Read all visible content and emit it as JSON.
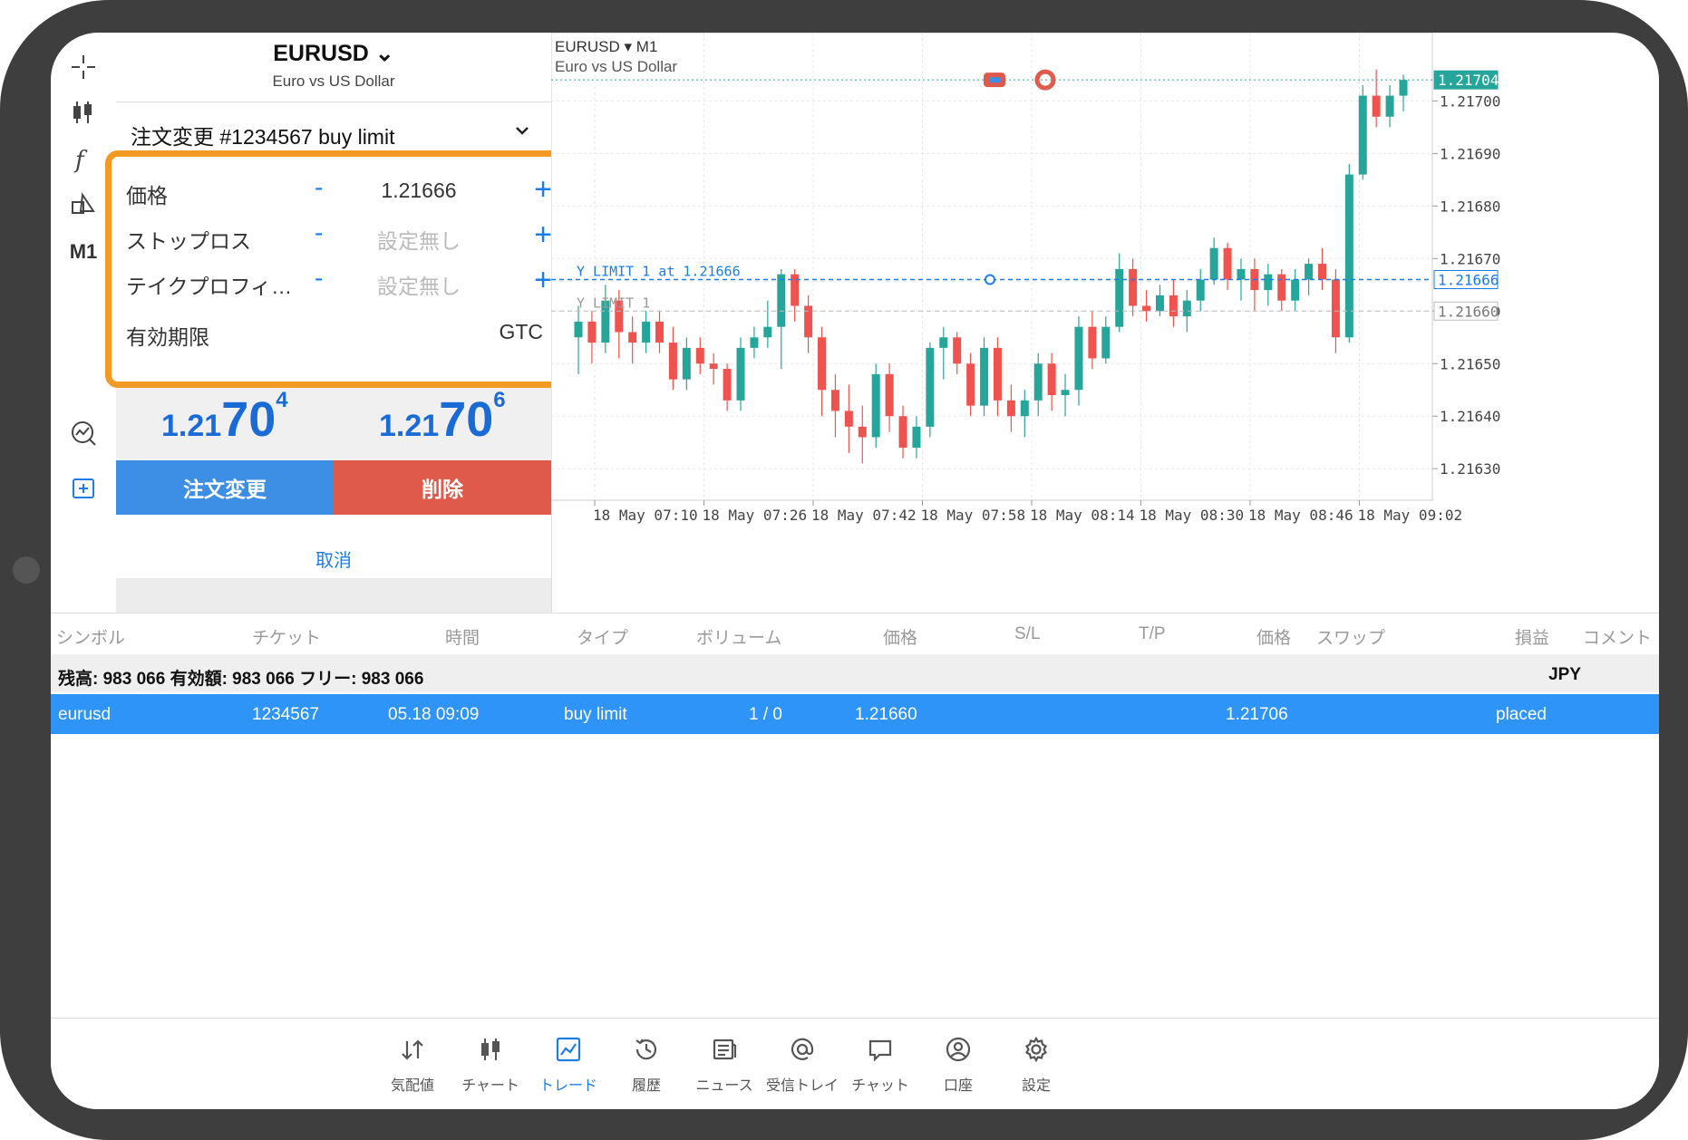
{
  "toolbar": {
    "timeframe": "M1"
  },
  "order_panel": {
    "symbol": "EURUSD",
    "symbol_chevron": "⌄",
    "symbol_desc": "Euro vs US Dollar",
    "order_title": "注文変更 #1234567 buy limit",
    "fields": {
      "price": {
        "label": "価格",
        "value": "1.21666"
      },
      "stop_loss": {
        "label": "ストップロス",
        "placeholder": "設定無し"
      },
      "take_profit": {
        "label": "テイクプロフィ…",
        "placeholder": "設定無し"
      },
      "expiry": {
        "label": "有効期限",
        "value": "GTC"
      }
    },
    "minus": "-",
    "plus": "+",
    "bid": {
      "front": "1.21",
      "big": "70",
      "sup": "4"
    },
    "ask": {
      "front": "1.21",
      "big": "70",
      "sup": "6"
    },
    "modify_button": "注文変更",
    "delete_button": "削除",
    "cancel_link": "取消"
  },
  "chart": {
    "symbol": "EURUSD",
    "timeframe": "M1",
    "description": "Euro vs US Dollar",
    "line_label_blue": "Y LIMIT 1 at 1.21666",
    "line_label_gray": "Y LIMIT 1",
    "current_price": "1.21704",
    "limit_price": "1.21666",
    "gray_price": "1.21660"
  },
  "chart_data": {
    "type": "candlestick",
    "title": "EURUSD, M1",
    "y_ticks": [
      "1.21700",
      "1.21690",
      "1.21680",
      "1.21670",
      "1.21660",
      "1.21650",
      "1.21640",
      "1.21630"
    ],
    "x_ticks": [
      "18 May 07:10",
      "18 May 07:26",
      "18 May 07:42",
      "18 May 07:58",
      "18 May 08:14",
      "18 May 08:30",
      "18 May 08:46",
      "18 May 09:02"
    ],
    "ylim": [
      1.21624,
      1.21713
    ],
    "candles": [
      [
        1.21655,
        1.21661,
        1.21648,
        1.21658
      ],
      [
        1.21658,
        1.2166,
        1.2165,
        1.21654
      ],
      [
        1.21654,
        1.21665,
        1.21652,
        1.21662
      ],
      [
        1.21662,
        1.21664,
        1.21651,
        1.21656
      ],
      [
        1.21656,
        1.21659,
        1.2165,
        1.21654
      ],
      [
        1.21654,
        1.2166,
        1.21652,
        1.21658
      ],
      [
        1.21658,
        1.2166,
        1.21652,
        1.21654
      ],
      [
        1.21654,
        1.21657,
        1.21645,
        1.21647
      ],
      [
        1.21647,
        1.21655,
        1.21645,
        1.21653
      ],
      [
        1.21653,
        1.21655,
        1.21648,
        1.2165
      ],
      [
        1.2165,
        1.21652,
        1.21646,
        1.21649
      ],
      [
        1.21649,
        1.2165,
        1.21641,
        1.21643
      ],
      [
        1.21643,
        1.21655,
        1.21641,
        1.21653
      ],
      [
        1.21653,
        1.21657,
        1.21651,
        1.21655
      ],
      [
        1.21655,
        1.21662,
        1.21653,
        1.21657
      ],
      [
        1.21657,
        1.21668,
        1.21649,
        1.21667
      ],
      [
        1.21667,
        1.21668,
        1.21658,
        1.21661
      ],
      [
        1.21661,
        1.21663,
        1.21652,
        1.21655
      ],
      [
        1.21655,
        1.21657,
        1.2164,
        1.21645
      ],
      [
        1.21645,
        1.21648,
        1.21636,
        1.21641
      ],
      [
        1.21641,
        1.21646,
        1.21633,
        1.21638
      ],
      [
        1.21638,
        1.21642,
        1.21631,
        1.21636
      ],
      [
        1.21636,
        1.2165,
        1.21634,
        1.21648
      ],
      [
        1.21648,
        1.2165,
        1.21637,
        1.2164
      ],
      [
        1.2164,
        1.21642,
        1.21632,
        1.21634
      ],
      [
        1.21634,
        1.2164,
        1.21632,
        1.21638
      ],
      [
        1.21638,
        1.21654,
        1.21636,
        1.21653
      ],
      [
        1.21653,
        1.21657,
        1.21647,
        1.21655
      ],
      [
        1.21655,
        1.21656,
        1.21648,
        1.2165
      ],
      [
        1.2165,
        1.21652,
        1.2164,
        1.21642
      ],
      [
        1.21642,
        1.21655,
        1.2164,
        1.21653
      ],
      [
        1.21653,
        1.21655,
        1.2164,
        1.21643
      ],
      [
        1.21643,
        1.21646,
        1.21637,
        1.2164
      ],
      [
        1.2164,
        1.21645,
        1.21636,
        1.21643
      ],
      [
        1.21643,
        1.21652,
        1.2164,
        1.2165
      ],
      [
        1.2165,
        1.21652,
        1.21641,
        1.21644
      ],
      [
        1.21644,
        1.21648,
        1.2164,
        1.21645
      ],
      [
        1.21645,
        1.21659,
        1.21642,
        1.21657
      ],
      [
        1.21657,
        1.2166,
        1.21649,
        1.21651
      ],
      [
        1.21651,
        1.21659,
        1.2165,
        1.21657
      ],
      [
        1.21657,
        1.21671,
        1.21656,
        1.21668
      ],
      [
        1.21668,
        1.2167,
        1.21659,
        1.21661
      ],
      [
        1.21661,
        1.21664,
        1.21658,
        1.2166
      ],
      [
        1.2166,
        1.21665,
        1.21659,
        1.21663
      ],
      [
        1.21663,
        1.21666,
        1.21657,
        1.21659
      ],
      [
        1.21659,
        1.21664,
        1.21656,
        1.21662
      ],
      [
        1.21662,
        1.21668,
        1.2166,
        1.21666
      ],
      [
        1.21666,
        1.21674,
        1.21665,
        1.21672
      ],
      [
        1.21672,
        1.21673,
        1.21664,
        1.21666
      ],
      [
        1.21666,
        1.2167,
        1.21662,
        1.21668
      ],
      [
        1.21668,
        1.2167,
        1.2166,
        1.21664
      ],
      [
        1.21664,
        1.21669,
        1.21661,
        1.21667
      ],
      [
        1.21667,
        1.21668,
        1.2166,
        1.21662
      ],
      [
        1.21662,
        1.21668,
        1.2166,
        1.21666
      ],
      [
        1.21666,
        1.2167,
        1.21663,
        1.21669
      ],
      [
        1.21669,
        1.21672,
        1.21664,
        1.21666
      ],
      [
        1.21666,
        1.21668,
        1.21652,
        1.21655
      ],
      [
        1.21655,
        1.21688,
        1.21654,
        1.21686
      ],
      [
        1.21686,
        1.21703,
        1.21685,
        1.21701
      ],
      [
        1.21701,
        1.21706,
        1.21695,
        1.21697
      ],
      [
        1.21697,
        1.21703,
        1.21695,
        1.21701
      ],
      [
        1.21701,
        1.21705,
        1.21698,
        1.21704
      ]
    ]
  },
  "table": {
    "headers": [
      "シンボル",
      "チケット",
      "時間",
      "タイプ",
      "ボリューム",
      "価格",
      "S/L",
      "T/P",
      "価格",
      "スワップ",
      "損益",
      "コメント"
    ],
    "balance_text": "残高: 983 066 有効額: 983 066 フリー: 983 066",
    "currency": "JPY",
    "row": {
      "symbol": "eurusd",
      "ticket": "1234567",
      "time": "05.18 09:09",
      "type": "buy limit",
      "volume": "1 / 0",
      "price": "1.21660",
      "current_price": "1.21706",
      "status": "placed"
    }
  },
  "bottom_nav": [
    {
      "label": "気配値",
      "icon": "quotes-icon"
    },
    {
      "label": "チャート",
      "icon": "chart-icon"
    },
    {
      "label": "トレード",
      "icon": "trade-icon",
      "active": true
    },
    {
      "label": "履歴",
      "icon": "history-icon"
    },
    {
      "label": "ニュース",
      "icon": "news-icon"
    },
    {
      "label": "受信トレイ",
      "icon": "mail-icon"
    },
    {
      "label": "チャット",
      "icon": "chat-icon"
    },
    {
      "label": "口座",
      "icon": "account-icon"
    },
    {
      "label": "設定",
      "icon": "settings-icon"
    }
  ],
  "colors": {
    "accent": "#1a7dea",
    "bull": "#26a69a",
    "bear": "#ef5350",
    "highlight": "#f29a21",
    "delete": "#e05a4b",
    "selected_row": "#2f94f8"
  }
}
